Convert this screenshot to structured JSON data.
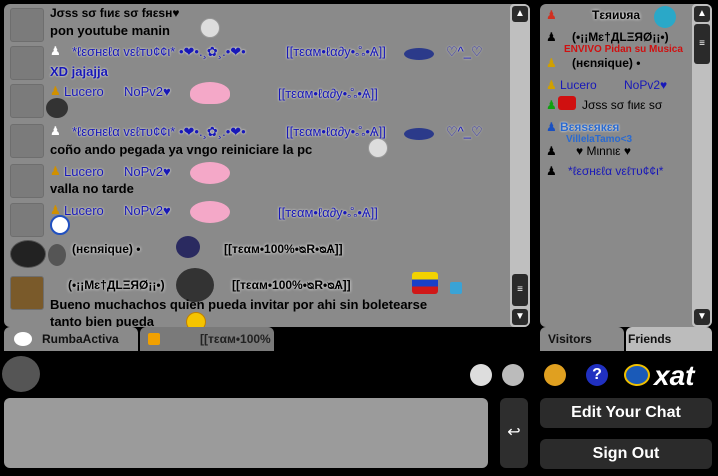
{
  "messages": [
    {
      "name": "",
      "text_top": "Jσss sσ fιиε sσ fяεsн♥",
      "text": "pon youtube manin"
    },
    {
      "name": "*ℓεσнεℓα vεℓтυ¢¢ι* •❤•.¸✿¸.•❤•",
      "name2": "[[тεαм•ℓα∂у•ஃ•Ѧ]]",
      "name3": "♡^_♡",
      "text": "XD jajajja"
    },
    {
      "name": "Lucero",
      "name2": "NoPv2♥",
      "name3": "[[тεαм•ℓα∂у•ஃ•Ѧ]]",
      "text": ""
    },
    {
      "name": "*ℓεσнεℓα vεℓтυ¢¢ι* •❤•.¸✿¸.•❤•",
      "name2": "[[тεαм•ℓα∂у•ஃ•Ѧ]]",
      "name3": "♡^_♡",
      "text": "coño ando pegada ya vngo reiniciare la pc"
    },
    {
      "name": "Lucero",
      "name2": "NoPv2♥",
      "text": "valla no tarde"
    },
    {
      "name": "Lucero",
      "name2": "NoPv2♥",
      "name3": "[[тεαм•ℓα∂у•ஃ•Ѧ]]",
      "text": ""
    },
    {
      "name": "(нєnяique) •",
      "name2": "[[тεαм•100%•ᴓR•ᴓѦ]]",
      "text": ""
    },
    {
      "name": "(•¡¡Mɛ†ДLΞЯØ¡¡•)",
      "name2": "[[тεαм•100%•ᴓR•ᴓѦ]]",
      "text": "Bueno muchachos quien pueda invitar por ahi sin boletearse",
      "text2": "tanto bien pueda"
    }
  ],
  "chat_tabs": {
    "main": "RumbaActiva",
    "pc": "[[тεαм•100%"
  },
  "users": [
    {
      "name": "Tεяиυяа"
    },
    {
      "name": "(•¡¡Mɛ†ДLΞЯØ¡¡•)",
      "sub": "ENVIVO Pidan su Musica"
    },
    {
      "name": "(нєnяique) •"
    },
    {
      "name": "Lucero",
      "name2": "NoPv2♥"
    },
    {
      "name": "Jσss sσ fιиε sσ"
    },
    {
      "name": "Bεяsεякεя",
      "sub": "VillelaTamo<3"
    },
    {
      "name": "♥ Mιnnιε ♥"
    },
    {
      "name": "*ℓεσнεℓα vεℓтυ¢¢ι*"
    }
  ],
  "user_tabs": {
    "visitors": "Visitors",
    "friends": "Friends"
  },
  "buttons": {
    "edit": "Edit Your Chat",
    "signout": "Sign Out",
    "send": "↩"
  },
  "brand": {
    "logo": "xat"
  },
  "icons": {
    "help": "?"
  }
}
